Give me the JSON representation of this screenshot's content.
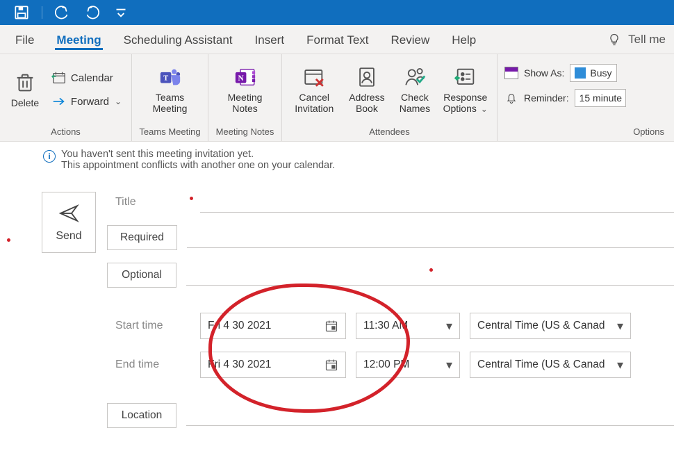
{
  "tabs": {
    "file": "File",
    "meeting": "Meeting",
    "scheduling": "Scheduling Assistant",
    "insert": "Insert",
    "format": "Format Text",
    "review": "Review",
    "help": "Help",
    "tellme": "Tell me"
  },
  "ribbon": {
    "actions": {
      "label": "Actions",
      "delete": "Delete",
      "calendar": "Calendar",
      "forward": "Forward"
    },
    "teams": {
      "label": "Teams Meeting",
      "button_line1": "Teams",
      "button_line2": "Meeting"
    },
    "notes": {
      "label": "Meeting Notes",
      "button_line1": "Meeting",
      "button_line2": "Notes"
    },
    "attendees": {
      "label": "Attendees",
      "cancel_line1": "Cancel",
      "cancel_line2": "Invitation",
      "address_line1": "Address",
      "address_line2": "Book",
      "check_line1": "Check",
      "check_line2": "Names",
      "response_line1": "Response",
      "response_line2": "Options"
    },
    "options": {
      "label": "Options",
      "showas_label": "Show As:",
      "showas_value": "Busy",
      "reminder_label": "Reminder:",
      "reminder_value": "15 minute"
    }
  },
  "info": {
    "line1": "You haven't sent this meeting invitation yet.",
    "line2": "This appointment conflicts with another one on your calendar."
  },
  "form": {
    "send": "Send",
    "title_label": "Title",
    "required_label": "Required",
    "optional_label": "Optional",
    "start_label": "Start time",
    "end_label": "End time",
    "location_label": "Location",
    "start_date": "Fri 4 30 2021",
    "end_date": "Fri 4 30 2021",
    "start_time": "11:30 AM",
    "end_time": "12:00 PM",
    "timezone": "Central Time (US & Canad",
    "title_value": "",
    "required_value": "",
    "optional_value": "",
    "location_value": ""
  },
  "colors": {
    "brand_blue": "#106ebe",
    "annotation_red": "#d3222a"
  }
}
